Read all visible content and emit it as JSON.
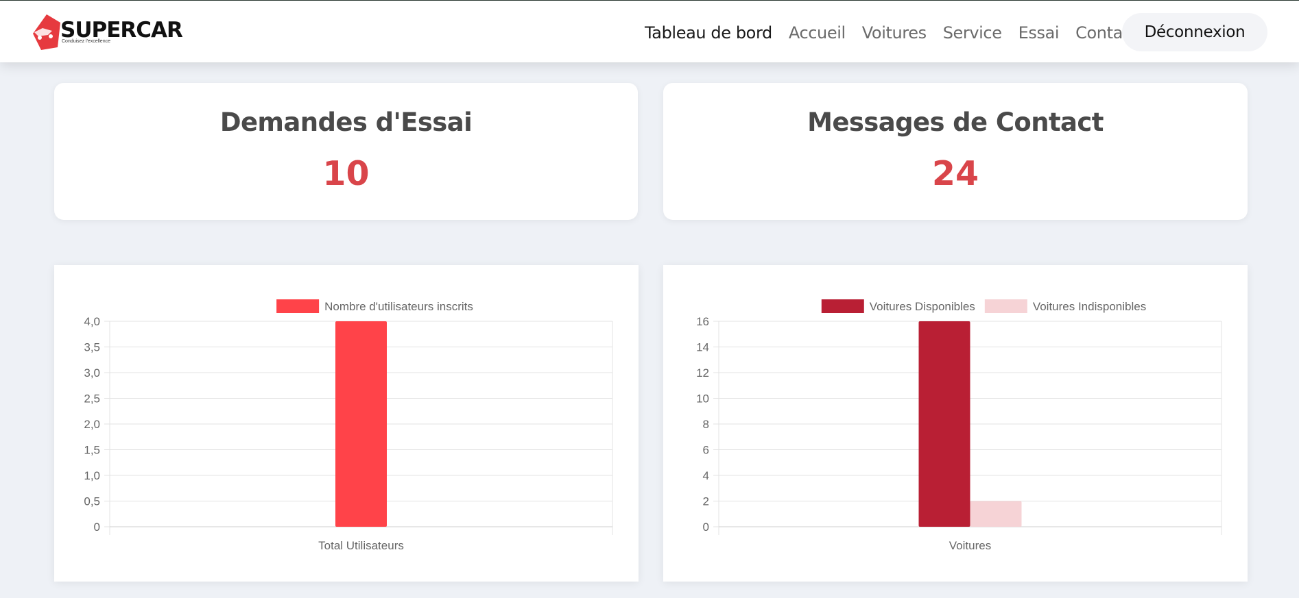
{
  "brand": {
    "name": "SUPERCAR",
    "tagline": "Conduisez l'excellence",
    "colors": {
      "accent": "#e63a3f",
      "value": "#d9454a"
    }
  },
  "nav": {
    "items": [
      {
        "label": "Tableau de bord",
        "active": true
      },
      {
        "label": "Accueil"
      },
      {
        "label": "Voitures"
      },
      {
        "label": "Service"
      },
      {
        "label": "Essai"
      },
      {
        "label": "Contact"
      }
    ],
    "logout_label": "Déconnexion"
  },
  "stats": {
    "trials": {
      "title": "Demandes d'Essai",
      "value": "10"
    },
    "messages": {
      "title": "Messages de Contact",
      "value": "24"
    }
  },
  "chart_data": [
    {
      "type": "bar",
      "categories": [
        "Total Utilisateurs"
      ],
      "series": [
        {
          "name": "Nombre d'utilisateurs inscrits",
          "values": [
            4
          ],
          "color": "#ff4349"
        }
      ],
      "ylim": [
        0,
        4
      ],
      "yticks": [
        0,
        0.5,
        1,
        1.5,
        2,
        2.5,
        3,
        3.5,
        4
      ],
      "ytick_labels": [
        "0",
        "0,5",
        "1,0",
        "1,5",
        "2,0",
        "2,5",
        "3,0",
        "3,5",
        "4,0"
      ],
      "grid": true,
      "legend": "top"
    },
    {
      "type": "bar",
      "categories": [
        "Voitures"
      ],
      "series": [
        {
          "name": "Voitures Disponibles",
          "values": [
            16
          ],
          "color": "#b91f34"
        },
        {
          "name": "Voitures Indisponibles",
          "values": [
            2
          ],
          "color": "#f6d3d6"
        }
      ],
      "ylim": [
        0,
        16
      ],
      "yticks": [
        0,
        2,
        4,
        6,
        8,
        10,
        12,
        14,
        16
      ],
      "ytick_labels": [
        "0",
        "2",
        "4",
        "6",
        "8",
        "10",
        "12",
        "14",
        "16"
      ],
      "grid": true,
      "legend": "top"
    }
  ]
}
